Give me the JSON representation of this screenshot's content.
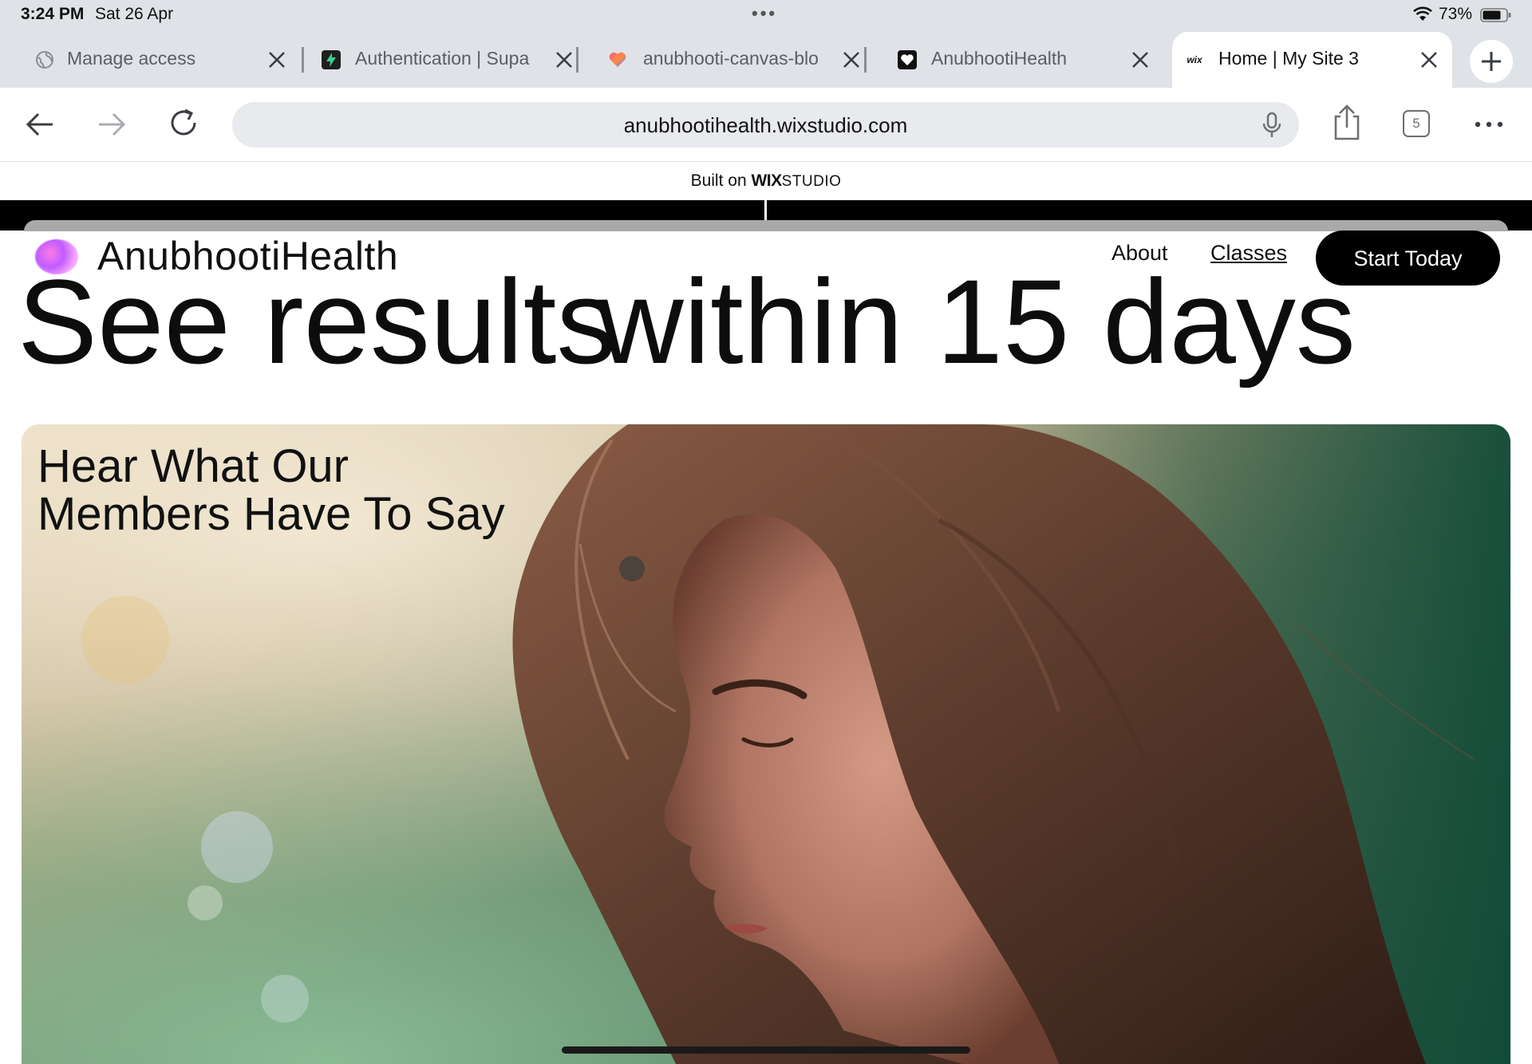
{
  "status_bar": {
    "time": "3:24 PM",
    "date": "Sat 26 Apr",
    "battery": "73%"
  },
  "tabs": [
    {
      "label": "Manage access",
      "icon": "globe-icon",
      "active": false
    },
    {
      "label": "Authentication | Supa",
      "icon": "supabase-icon",
      "active": false
    },
    {
      "label": "anubhooti-canvas-blo",
      "icon": "heart-icon",
      "active": false
    },
    {
      "label": "AnubhootiHealth",
      "icon": "heart-outline-icon",
      "active": false
    },
    {
      "label": "Home | My Site 3",
      "icon": "wix-icon",
      "active": true
    }
  ],
  "toolbar": {
    "url": "anubhootihealth.wixstudio.com",
    "tab_count": "5"
  },
  "built_on": {
    "prefix": "Built on ",
    "brand": "WIX",
    "suffix": "STUDIO"
  },
  "site": {
    "brand": "AnubhootiHealth",
    "nav": {
      "about": "About",
      "classes": "Classes",
      "cta": "Start Today"
    },
    "headline_part1": "See results",
    "headline_part2": "within 15 days",
    "testimonial_line1": "Hear What Our",
    "testimonial_line2": "Members Have To Say"
  },
  "colors": {
    "accent": "#000000",
    "tab_strip": "#dfe2e6",
    "url_bar": "#e8eaed"
  }
}
